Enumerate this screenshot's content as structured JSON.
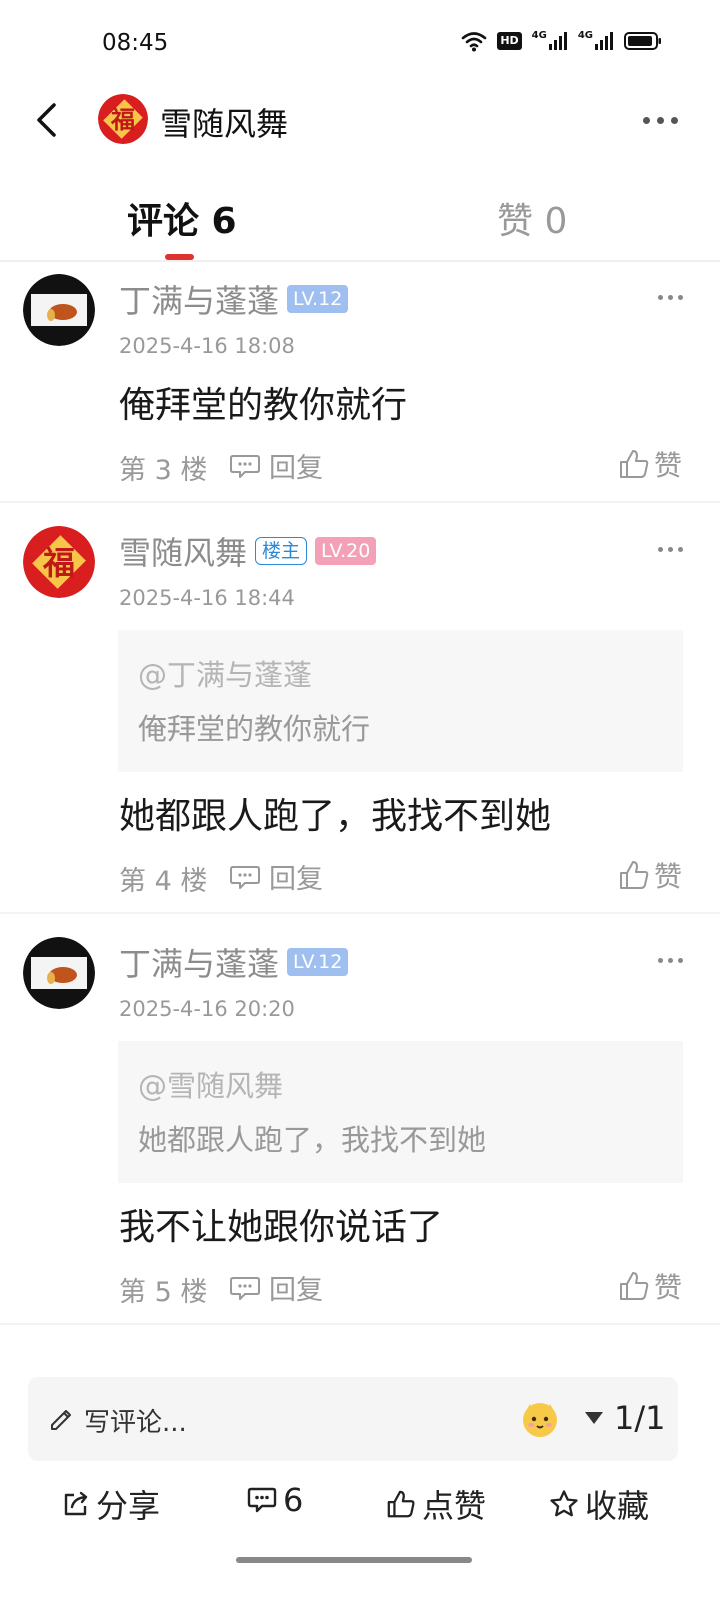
{
  "status_bar": {
    "time": "08:45",
    "hd_label": "HD",
    "net1_label": "4G",
    "net2_label": "4G"
  },
  "header": {
    "title": "雪随风舞",
    "avatar_glyph": "福"
  },
  "tabs": [
    {
      "label": "评论 6",
      "active": true
    },
    {
      "label": "赞 0",
      "active": false
    }
  ],
  "colors": {
    "accent": "#e03131",
    "lv_blue": "#9ebff0",
    "lv_pink": "#f3a1b6",
    "owner_blue": "#2b8ad8"
  },
  "comments": [
    {
      "username": "丁满与蓬蓬",
      "level": "LV.12",
      "time": "2025-4-16 18:08",
      "text": "俺拜堂的教你就行",
      "floor": "第 3 楼",
      "reply_label": "回复",
      "like_label": "赞"
    },
    {
      "username": "雪随风舞",
      "owner_badge": "楼主",
      "level": "LV.20",
      "time": "2025-4-16 18:44",
      "quote_user": "@丁满与蓬蓬",
      "quote_text": "俺拜堂的教你就行",
      "text": "她都跟人跑了，我找不到她",
      "floor": "第 4 楼",
      "reply_label": "回复",
      "like_label": "赞",
      "avatar_glyph": "福"
    },
    {
      "username": "丁满与蓬蓬",
      "level": "LV.12",
      "time": "2025-4-16 20:20",
      "quote_user": "@雪随风舞",
      "quote_text": "她都跟人跑了，我找不到她",
      "text": "我不让她跟你说话了",
      "floor": "第 5 楼",
      "reply_label": "回复",
      "like_label": "赞"
    }
  ],
  "bottom": {
    "input_placeholder": "写评论...",
    "page_indicator": "1/1",
    "share_label": "分享",
    "comment_count": "6",
    "like_label": "点赞",
    "favorite_label": "收藏"
  }
}
